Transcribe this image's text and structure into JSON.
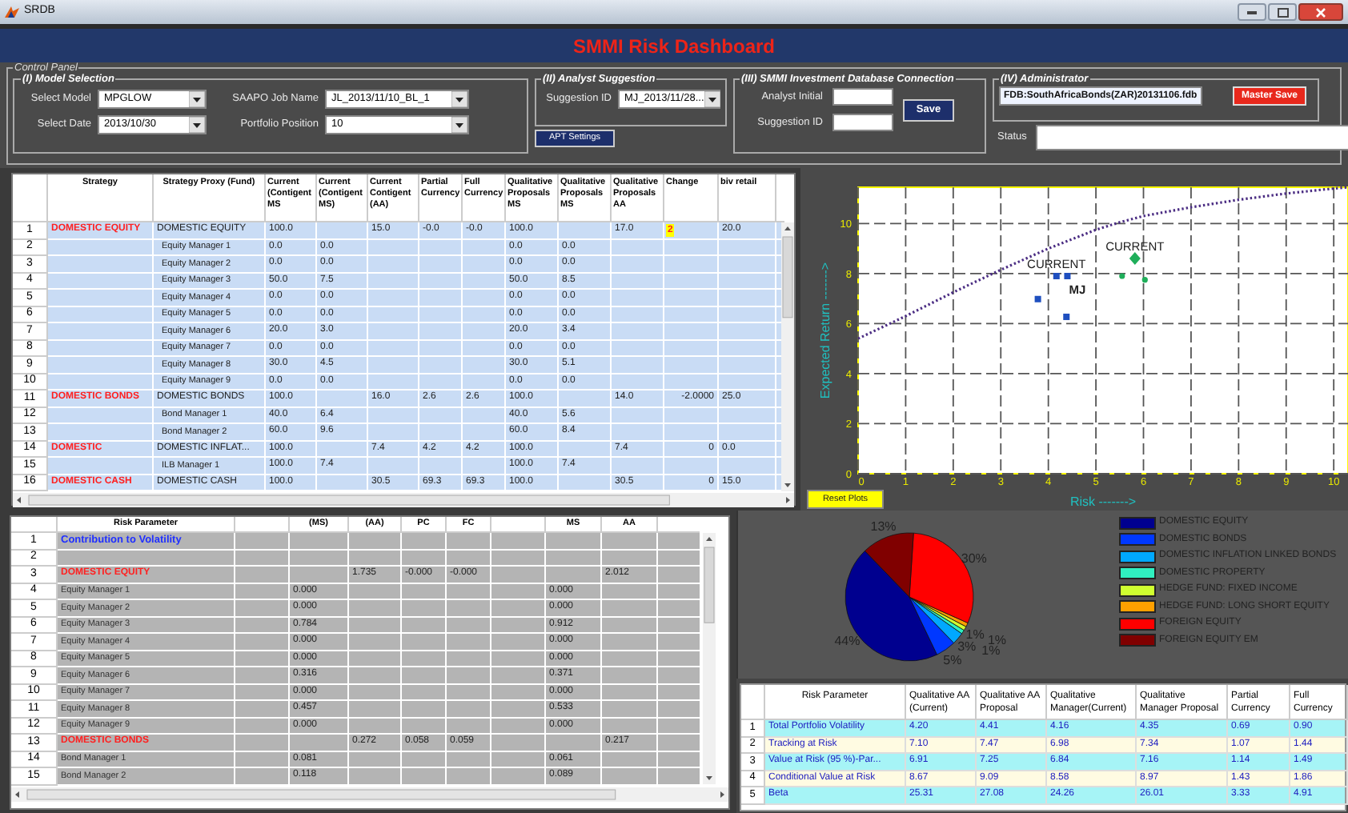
{
  "window": {
    "title": "SRDB"
  },
  "header": {
    "title": "SMMI Risk Dashboard"
  },
  "control_panel": {
    "title": "Control Panel",
    "model_selection": {
      "title": "(I) Model Selection",
      "fields": [
        {
          "label": "Select Model",
          "value": "MPGLOW"
        },
        {
          "label": "SAAPO Job Name",
          "value": "JL_2013/11/10_BL_1"
        },
        {
          "label": "Select Date",
          "value": "2013/10/30"
        },
        {
          "label": "Portfolio Position",
          "value": "10"
        }
      ]
    },
    "analyst_suggestion": {
      "title": "(II) Analyst Suggestion",
      "label": "Suggestion ID",
      "value": "MJ_2013/11/28..."
    },
    "apt_button": "APT Settings",
    "database": {
      "title": "(III) SMMI Investment Database Connection",
      "fields": [
        {
          "label": "Analyst Initial"
        },
        {
          "label": "Suggestion ID"
        }
      ],
      "button": "Save"
    },
    "administrator": {
      "title": "(IV) Administrator",
      "file": "FDB:SouthAfricaBonds(ZAR)20131106.fdb",
      "button": "Master Save"
    },
    "status": {
      "label": "Status"
    }
  },
  "top_table": {
    "columns": [
      "Strategy",
      "Strategy Proxy (Fund)",
      "Current (Contigent MS",
      "Current (Contigent MS)",
      "Current Contigent (AA)",
      "Partial Currency",
      "Full Currency",
      "Qualitative Proposals MS",
      "Qualitative Proposals MS",
      "Qualitative Proposals AA",
      "Change",
      "biv retail"
    ],
    "rows": [
      {
        "number": "1",
        "kind": "group",
        "highlighted": true,
        "cells": [
          "DOMESTIC EQUITY",
          "DOMESTIC EQUITY",
          "100.0",
          null,
          "15.0",
          "-0.0",
          "-0.0",
          "100.0",
          null,
          "17.0",
          "2",
          "20.0"
        ]
      },
      {
        "number": "2",
        "kind": "item",
        "highlighted": false,
        "cells": [
          null,
          "Equity Manager 1",
          "0.0",
          "0.0",
          null,
          null,
          null,
          "0.0",
          "0.0",
          null,
          null,
          null
        ]
      },
      {
        "number": "3",
        "kind": "item",
        "highlighted": false,
        "cells": [
          null,
          "Equity Manager 2",
          "0.0",
          "0.0",
          null,
          null,
          null,
          "0.0",
          "0.0",
          null,
          null,
          null
        ]
      },
      {
        "number": "4",
        "kind": "item",
        "highlighted": false,
        "cells": [
          null,
          "Equity Manager 3",
          "50.0",
          "7.5",
          null,
          null,
          null,
          "50.0",
          "8.5",
          null,
          null,
          null
        ]
      },
      {
        "number": "5",
        "kind": "item",
        "highlighted": false,
        "cells": [
          null,
          "Equity Manager 4",
          "0.0",
          "0.0",
          null,
          null,
          null,
          "0.0",
          "0.0",
          null,
          null,
          null
        ]
      },
      {
        "number": "6",
        "kind": "item",
        "highlighted": false,
        "cells": [
          null,
          "Equity Manager 5",
          "0.0",
          "0.0",
          null,
          null,
          null,
          "0.0",
          "0.0",
          null,
          null,
          null
        ]
      },
      {
        "number": "7",
        "kind": "item",
        "highlighted": false,
        "cells": [
          null,
          "Equity Manager 6",
          "20.0",
          "3.0",
          null,
          null,
          null,
          "20.0",
          "3.4",
          null,
          null,
          null
        ]
      },
      {
        "number": "8",
        "kind": "item",
        "highlighted": false,
        "cells": [
          null,
          "Equity Manager 7",
          "0.0",
          "0.0",
          null,
          null,
          null,
          "0.0",
          "0.0",
          null,
          null,
          null
        ]
      },
      {
        "number": "9",
        "kind": "item",
        "highlighted": false,
        "cells": [
          null,
          "Equity Manager 8",
          "30.0",
          "4.5",
          null,
          null,
          null,
          "30.0",
          "5.1",
          null,
          null,
          null
        ]
      },
      {
        "number": "10",
        "kind": "item",
        "highlighted": false,
        "cells": [
          null,
          "Equity Manager 9",
          "0.0",
          "0.0",
          null,
          null,
          null,
          "0.0",
          "0.0",
          null,
          null,
          null
        ]
      },
      {
        "number": "11",
        "kind": "group",
        "highlighted": false,
        "cells": [
          "DOMESTIC BONDS",
          "DOMESTIC BONDS",
          "100.0",
          null,
          "16.0",
          "2.6",
          "2.6",
          "100.0",
          null,
          "14.0",
          "-2.0000",
          "25.0"
        ]
      },
      {
        "number": "12",
        "kind": "item",
        "highlighted": false,
        "cells": [
          null,
          "Bond Manager 1",
          "40.0",
          "6.4",
          null,
          null,
          null,
          "40.0",
          "5.6",
          null,
          null,
          null
        ]
      },
      {
        "number": "13",
        "kind": "item",
        "highlighted": false,
        "cells": [
          null,
          "Bond Manager 2",
          "60.0",
          "9.6",
          null,
          null,
          null,
          "60.0",
          "8.4",
          null,
          null,
          null
        ]
      },
      {
        "number": "14",
        "kind": "group",
        "highlighted": false,
        "cells": [
          "DOMESTIC",
          "DOMESTIC INFLAT...",
          "100.0",
          null,
          "7.4",
          "4.2",
          "4.2",
          "100.0",
          null,
          "7.4",
          "0",
          "0.0"
        ]
      },
      {
        "number": "15",
        "kind": "item",
        "highlighted": false,
        "cells": [
          null,
          "ILB Manager 1",
          "100.0",
          "7.4",
          null,
          null,
          null,
          "100.0",
          "7.4",
          null,
          null,
          null
        ]
      },
      {
        "number": "16",
        "kind": "group",
        "highlighted": false,
        "cells": [
          "DOMESTIC CASH",
          "DOMESTIC CASH",
          "100.0",
          null,
          "30.5",
          "69.3",
          "69.3",
          "100.0",
          null,
          "30.5",
          "0",
          "15.0"
        ]
      }
    ]
  },
  "chart": {
    "reset_button": "Reset Plots",
    "chart_data": {
      "type": "scatter",
      "xlabel": "Risk ------->",
      "ylabel": "Expected Return ------->",
      "grid": true,
      "xlim": [
        0,
        10.3
      ],
      "ylim": [
        0,
        11.45
      ],
      "xticks": [
        0,
        1,
        2,
        3,
        4,
        5,
        6,
        7,
        8,
        9,
        10
      ],
      "yticks": [
        0,
        2,
        4,
        6,
        8,
        10
      ],
      "series": [
        {
          "type": "line",
          "line_style": "dotted",
          "color": "#4b2d83",
          "x": [
            0,
            1,
            2,
            3,
            4,
            5,
            5.5,
            6,
            7,
            8,
            9,
            10,
            10.3
          ],
          "values": [
            5.4,
            6.3,
            7.25,
            8.15,
            9.0,
            9.75,
            10.05,
            10.3,
            10.65,
            10.95,
            11.2,
            11.4,
            11.45
          ]
        },
        {
          "marker": "square",
          "color": "#1f4fbf",
          "x": [
            4.17,
            3.78,
            4.38
          ],
          "values": [
            7.9,
            6.98,
            6.27
          ]
        },
        {
          "marker": "square",
          "color": "#1f4fbf",
          "x": [
            4.4
          ],
          "values": [
            7.9
          ]
        },
        {
          "marker": "diamond",
          "color": "#1fae5a",
          "x": [
            5.82
          ],
          "values": [
            8.6
          ]
        },
        {
          "marker": "circle",
          "color": "#1fae5a",
          "x": [
            5.55,
            6.03
          ],
          "values": [
            7.9,
            7.75
          ]
        }
      ],
      "annotations": [
        {
          "text": "CURRENT",
          "x": 4.17,
          "y": 7.9
        },
        {
          "text": "MJ",
          "x": 4.4,
          "y": 7.9
        },
        {
          "text": "CURRENT",
          "x": 5.82,
          "y": 8.6
        }
      ]
    }
  },
  "bottom_table": {
    "columns": [
      "Risk Parameter",
      null,
      "(MS)",
      "(AA)",
      "PC",
      "FC",
      null,
      "MS",
      "AA"
    ],
    "rows": [
      {
        "number": "1",
        "kind": "section",
        "cells": [
          "Contribution to Volatility",
          null,
          null,
          null,
          null,
          null,
          null,
          null,
          null
        ]
      },
      {
        "number": "2",
        "cells": [
          null,
          null,
          null,
          null,
          null,
          null,
          null,
          null,
          null
        ]
      },
      {
        "number": "3",
        "kind": "group",
        "cells": [
          "DOMESTIC EQUITY",
          null,
          null,
          "1.735",
          "-0.000",
          "-0.000",
          null,
          null,
          "2.012"
        ]
      },
      {
        "number": "4",
        "kind": "item",
        "cells": [
          "Equity Manager 1",
          null,
          "0.000",
          null,
          null,
          null,
          null,
          "0.000",
          null
        ]
      },
      {
        "number": "5",
        "kind": "item",
        "cells": [
          "Equity Manager 2",
          null,
          "0.000",
          null,
          null,
          null,
          null,
          "0.000",
          null
        ]
      },
      {
        "number": "6",
        "kind": "item",
        "cells": [
          "Equity Manager 3",
          null,
          "0.784",
          null,
          null,
          null,
          null,
          "0.912",
          null
        ]
      },
      {
        "number": "7",
        "kind": "item",
        "cells": [
          "Equity Manager 4",
          null,
          "0.000",
          null,
          null,
          null,
          null,
          "0.000",
          null
        ]
      },
      {
        "number": "8",
        "kind": "item",
        "cells": [
          "Equity Manager 5",
          null,
          "0.000",
          null,
          null,
          null,
          null,
          "0.000",
          null
        ]
      },
      {
        "number": "9",
        "kind": "item",
        "cells": [
          "Equity Manager 6",
          null,
          "0.316",
          null,
          null,
          null,
          null,
          "0.371",
          null
        ]
      },
      {
        "number": "10",
        "kind": "item",
        "cells": [
          "Equity Manager 7",
          null,
          "0.000",
          null,
          null,
          null,
          null,
          "0.000",
          null
        ]
      },
      {
        "number": "11",
        "kind": "item",
        "cells": [
          "Equity Manager 8",
          null,
          "0.457",
          null,
          null,
          null,
          null,
          "0.533",
          null
        ]
      },
      {
        "number": "12",
        "kind": "item",
        "cells": [
          "Equity Manager 9",
          null,
          "0.000",
          null,
          null,
          null,
          null,
          "0.000",
          null
        ]
      },
      {
        "number": "13",
        "kind": "group",
        "cells": [
          "DOMESTIC BONDS",
          null,
          null,
          "0.272",
          "0.058",
          "0.059",
          null,
          null,
          "0.217"
        ]
      },
      {
        "number": "14",
        "kind": "item",
        "cells": [
          "Bond Manager 1",
          null,
          "0.081",
          null,
          null,
          null,
          null,
          "0.061",
          null
        ]
      },
      {
        "number": "15",
        "kind": "item",
        "cells": [
          "Bond Manager 2",
          null,
          "0.118",
          null,
          null,
          null,
          null,
          "0.089",
          null
        ]
      }
    ]
  },
  "pie": {
    "chart_data": {
      "type": "pie",
      "categories": [
        "DOMESTIC EQUITY",
        "DOMESTIC BONDS",
        "DOMESTIC INFLATION LINKED BONDS",
        "DOMESTIC PROPERTY",
        "HEDGE FUND: FIXED INCOME",
        "HEDGE FUND: LONG SHORT EQUITY",
        "FOREIGN EQUITY",
        "FOREIGN EQUITY EM"
      ],
      "values": [
        44,
        5,
        3,
        1,
        1,
        1,
        30,
        13
      ],
      "colors": [
        "#00008f",
        "#0038ff",
        "#00a8ff",
        "#30f0c0",
        "#d0ff30",
        "#ffa000",
        "#ff0000",
        "#800000"
      ],
      "value_labels": [
        "44%",
        "5%",
        "3%",
        "1%",
        "1%",
        "1%",
        "30%",
        "13%"
      ]
    }
  },
  "risk_table": {
    "columns": [
      "Risk Parameter",
      "Qualitative AA (Current)",
      "Qualitative AA Proposal",
      "Qualitative Manager(Current)",
      "Qualitative Manager Proposal",
      "Partial Currency",
      "Full Currency"
    ],
    "rows": [
      {
        "number": "1",
        "cells": [
          "Total Portfolio Volatility",
          "4.20",
          "4.41",
          "4.16",
          "4.35",
          "0.69",
          "0.90"
        ]
      },
      {
        "number": "2",
        "cells": [
          "Tracking at Risk",
          "7.10",
          "7.47",
          "6.98",
          "7.34",
          "1.07",
          "1.44"
        ]
      },
      {
        "number": "3",
        "cells": [
          "Value at Risk (95 %)-Par...",
          "6.91",
          "7.25",
          "6.84",
          "7.16",
          "1.14",
          "1.49"
        ]
      },
      {
        "number": "4",
        "cells": [
          "Conditional Value at Risk",
          "8.67",
          "9.09",
          "8.58",
          "8.97",
          "1.43",
          "1.86"
        ]
      },
      {
        "number": "5",
        "cells": [
          "Beta",
          "25.31",
          "27.08",
          "24.26",
          "26.01",
          "3.33",
          "4.91"
        ]
      }
    ]
  }
}
